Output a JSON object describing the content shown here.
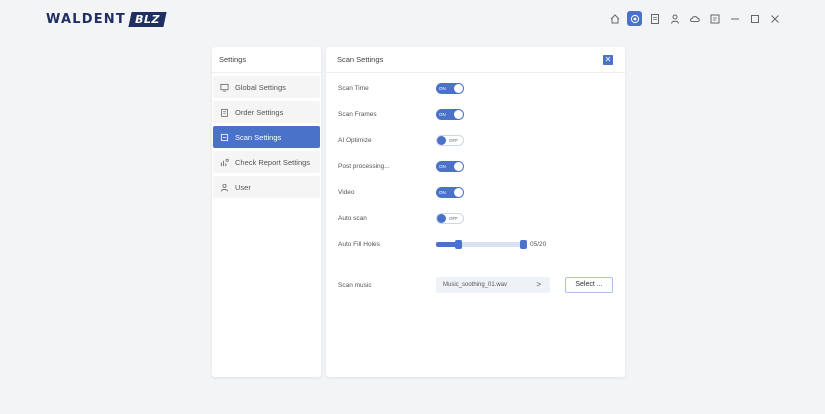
{
  "brand": {
    "name": "WALDENT",
    "badge": "BLZ"
  },
  "window_icons": [
    {
      "name": "home-icon",
      "active": false
    },
    {
      "name": "settings-icon",
      "active": true
    },
    {
      "name": "document-icon",
      "active": false
    },
    {
      "name": "user-icon",
      "active": false
    },
    {
      "name": "cloud-icon",
      "active": false
    },
    {
      "name": "report-icon",
      "active": false
    },
    {
      "name": "minimize-icon",
      "active": false
    },
    {
      "name": "maximize-icon",
      "active": false
    },
    {
      "name": "close-icon",
      "active": false
    }
  ],
  "sidebar": {
    "title": "Settings",
    "items": [
      {
        "label": "Global Settings",
        "icon": "monitor-icon",
        "active": false
      },
      {
        "label": "Order Settings",
        "icon": "clipboard-icon",
        "active": false
      },
      {
        "label": "Scan Settings",
        "icon": "scan-icon",
        "active": true
      },
      {
        "label": "Check Report Settings",
        "icon": "report-settings-icon",
        "active": false
      },
      {
        "label": "User",
        "icon": "user-icon",
        "active": false
      }
    ]
  },
  "main": {
    "title": "Scan Settings",
    "settings": [
      {
        "label": "Scan Time",
        "state": "ON"
      },
      {
        "label": "Scan Frames",
        "state": "ON"
      },
      {
        "label": "AI Optimize",
        "state": "OFF"
      },
      {
        "label": "Post processing...",
        "state": "ON"
      },
      {
        "label": "Video",
        "state": "ON"
      },
      {
        "label": "Auto scan",
        "state": "OFF"
      }
    ],
    "auto_fill": {
      "label": "Auto Fill Holes",
      "value_text": "05/20",
      "value": 5,
      "max": 20
    },
    "scan_music": {
      "label": "Scan music",
      "value": "Music_soothing_01.wav",
      "button": "Select ..."
    }
  },
  "colors": {
    "accent": "#4a72c9",
    "brand": "#1f2f63",
    "background": "#f3f4f6"
  }
}
